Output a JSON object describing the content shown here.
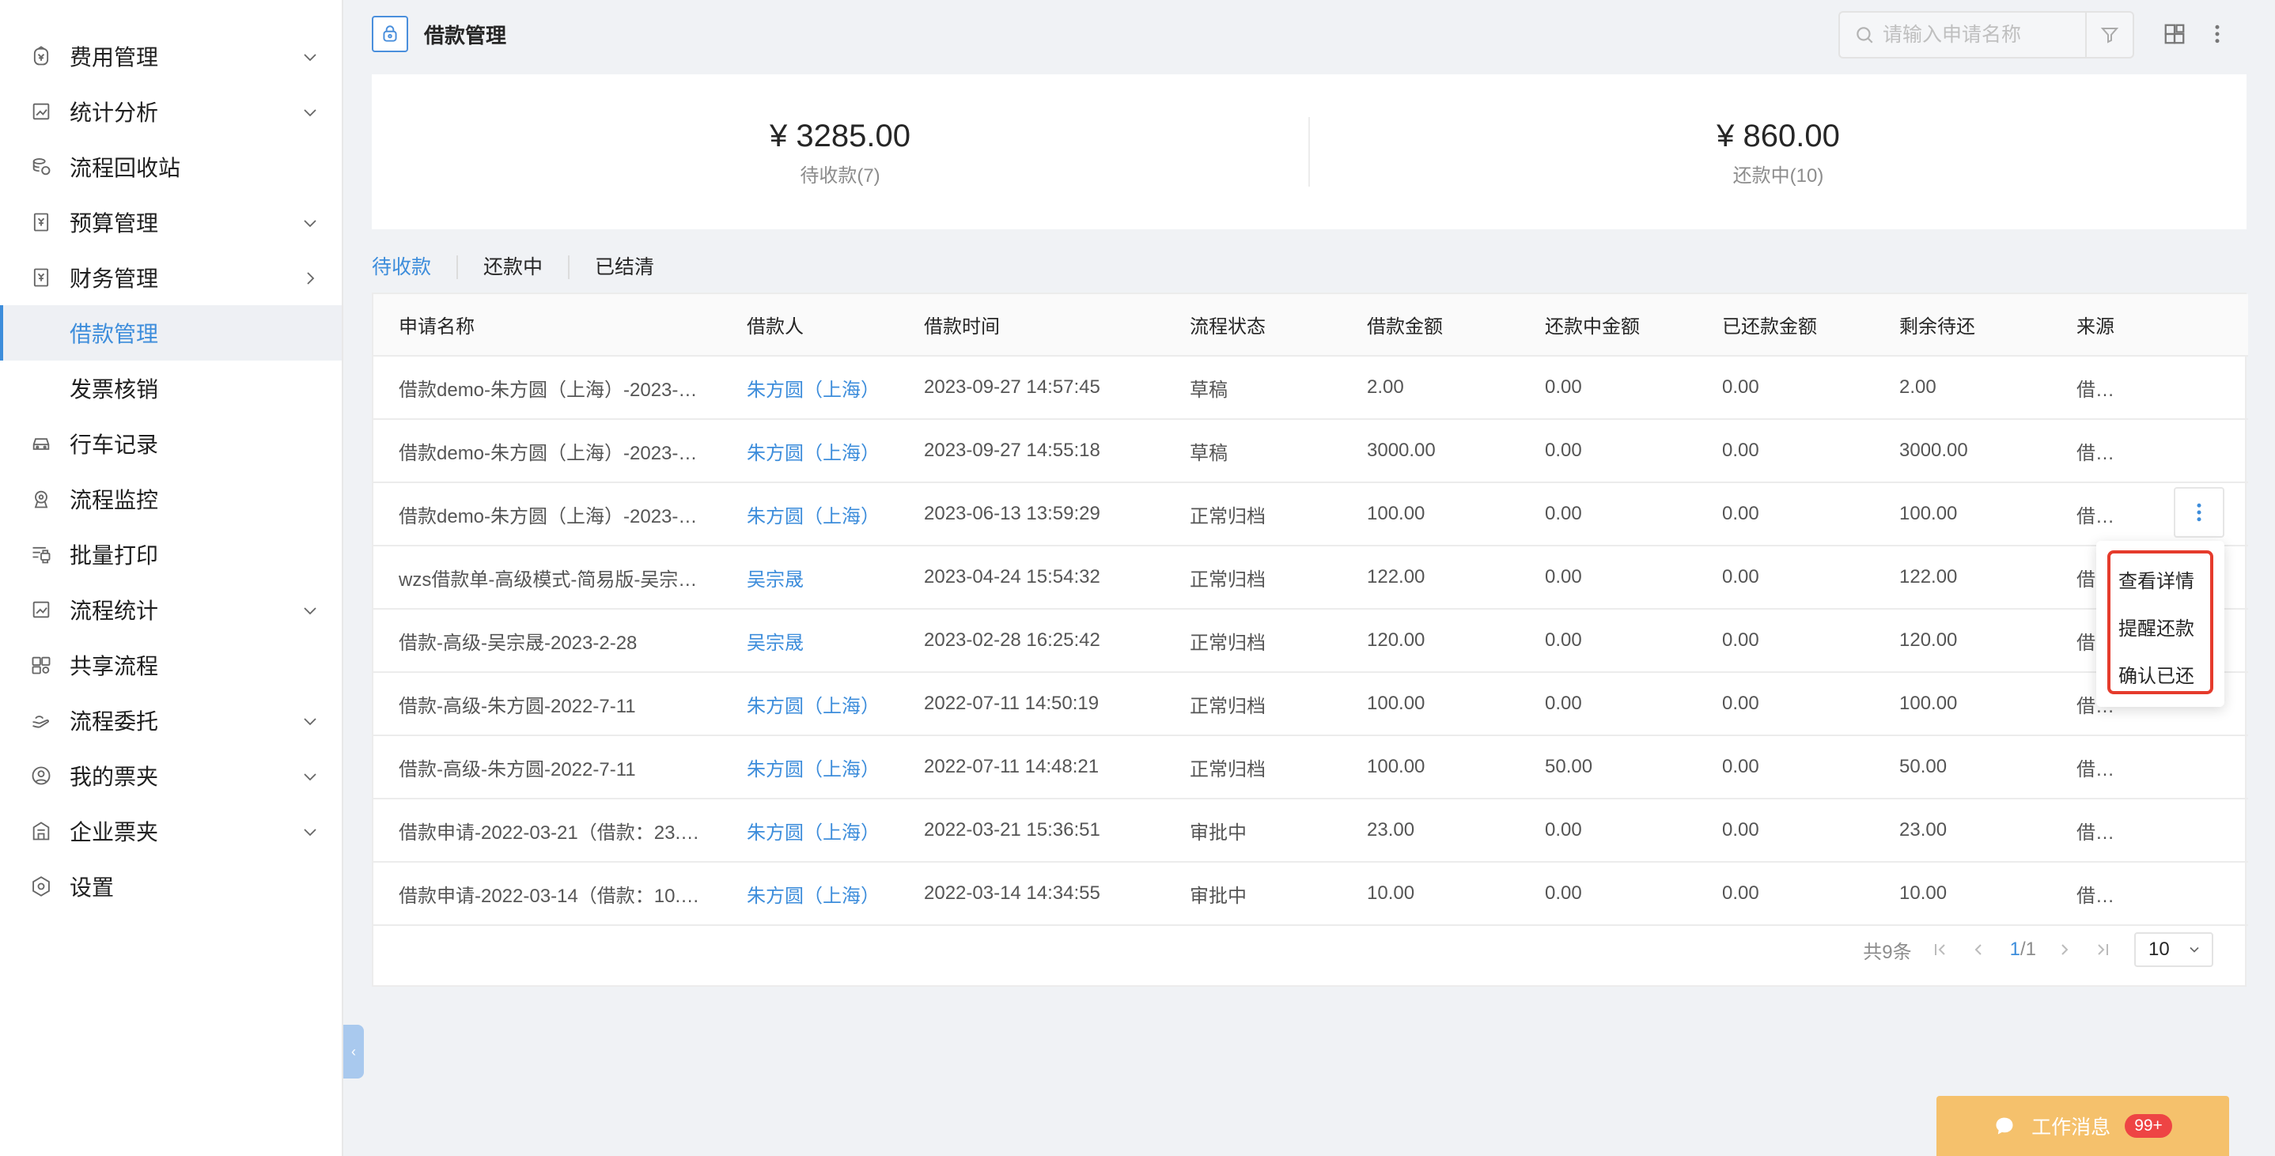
{
  "sidebar": {
    "items": [
      {
        "label": "费用管理",
        "icon": "coin-icon",
        "arrow": "down"
      },
      {
        "label": "统计分析",
        "icon": "chart-icon",
        "arrow": "down"
      },
      {
        "label": "流程回收站",
        "icon": "recycle-icon",
        "arrow": ""
      },
      {
        "label": "预算管理",
        "icon": "budget-icon",
        "arrow": "down"
      },
      {
        "label": "财务管理",
        "icon": "finance-icon",
        "arrow": "right"
      },
      {
        "label": "借款管理",
        "icon": "",
        "arrow": "",
        "sub": true,
        "active": true
      },
      {
        "label": "发票核销",
        "icon": "",
        "arrow": "",
        "sub": true
      },
      {
        "label": "行车记录",
        "icon": "car-icon",
        "arrow": ""
      },
      {
        "label": "流程监控",
        "icon": "monitor-icon",
        "arrow": ""
      },
      {
        "label": "批量打印",
        "icon": "print-icon",
        "arrow": ""
      },
      {
        "label": "流程统计",
        "icon": "stats-icon",
        "arrow": "down"
      },
      {
        "label": "共享流程",
        "icon": "share-icon",
        "arrow": ""
      },
      {
        "label": "流程委托",
        "icon": "delegate-icon",
        "arrow": "down"
      },
      {
        "label": "我的票夹",
        "icon": "user-icon",
        "arrow": "down"
      },
      {
        "label": "企业票夹",
        "icon": "building-icon",
        "arrow": "down"
      },
      {
        "label": "设置",
        "icon": "settings-icon",
        "arrow": ""
      }
    ]
  },
  "header": {
    "title": "借款管理",
    "search_placeholder": "请输入申请名称"
  },
  "summary": [
    {
      "amount": "¥ 3285.00",
      "label": "待收款(7)"
    },
    {
      "amount": "¥ 860.00",
      "label": "还款中(10)"
    }
  ],
  "tabs": [
    {
      "label": "待收款",
      "active": true
    },
    {
      "label": "还款中",
      "active": false
    },
    {
      "label": "已结清",
      "active": false
    }
  ],
  "table": {
    "columns": [
      "申请名称",
      "借款人",
      "借款时间",
      "流程状态",
      "借款金额",
      "还款中金额",
      "已还款金额",
      "剩余待还",
      "来源"
    ],
    "rows": [
      [
        "借款demo-朱方圆（上海）-2023-…",
        "朱方圆（上海）",
        "2023-09-27 14:57:45",
        "草稿",
        "2.00",
        "0.00",
        "0.00",
        "2.00",
        "借…"
      ],
      [
        "借款demo-朱方圆（上海）-2023-…",
        "朱方圆（上海）",
        "2023-09-27 14:55:18",
        "草稿",
        "3000.00",
        "0.00",
        "0.00",
        "3000.00",
        "借…"
      ],
      [
        "借款demo-朱方圆（上海）-2023-…",
        "朱方圆（上海）",
        "2023-06-13 13:59:29",
        "正常归档",
        "100.00",
        "0.00",
        "0.00",
        "100.00",
        "借…"
      ],
      [
        "wzs借款单-高级模式-简易版-吴宗…",
        "吴宗晟",
        "2023-04-24 15:54:32",
        "正常归档",
        "122.00",
        "0.00",
        "0.00",
        "122.00",
        "借…"
      ],
      [
        "借款-高级-吴宗晟-2023-2-28",
        "吴宗晟",
        "2023-02-28 16:25:42",
        "正常归档",
        "120.00",
        "0.00",
        "0.00",
        "120.00",
        "借…"
      ],
      [
        "借款-高级-朱方圆-2022-7-11",
        "朱方圆（上海）",
        "2022-07-11 14:50:19",
        "正常归档",
        "100.00",
        "0.00",
        "0.00",
        "100.00",
        "借…"
      ],
      [
        "借款-高级-朱方圆-2022-7-11",
        "朱方圆（上海）",
        "2022-07-11 14:48:21",
        "正常归档",
        "100.00",
        "50.00",
        "0.00",
        "50.00",
        "借…"
      ],
      [
        "借款申请-2022-03-21（借款：23.…",
        "朱方圆（上海）",
        "2022-03-21 15:36:51",
        "审批中",
        "23.00",
        "0.00",
        "0.00",
        "23.00",
        "借…"
      ],
      [
        "借款申请-2022-03-14（借款：10.…",
        "朱方圆（上海）",
        "2022-03-14 14:34:55",
        "审批中",
        "10.00",
        "0.00",
        "0.00",
        "10.00",
        "借…"
      ]
    ]
  },
  "pagination": {
    "total": "共9条",
    "current": "1",
    "pages": "/1",
    "page_size": "10"
  },
  "action_menu": {
    "items": [
      "查看详情",
      "提醒还款",
      "确认已还"
    ]
  },
  "work_message": {
    "label": "工作消息",
    "badge": "99+"
  },
  "colors": {
    "accent": "#3d8ddb",
    "highlight": "#e53b2c",
    "work_message_bg": "#f5c16c",
    "badge": "#ee4444"
  }
}
